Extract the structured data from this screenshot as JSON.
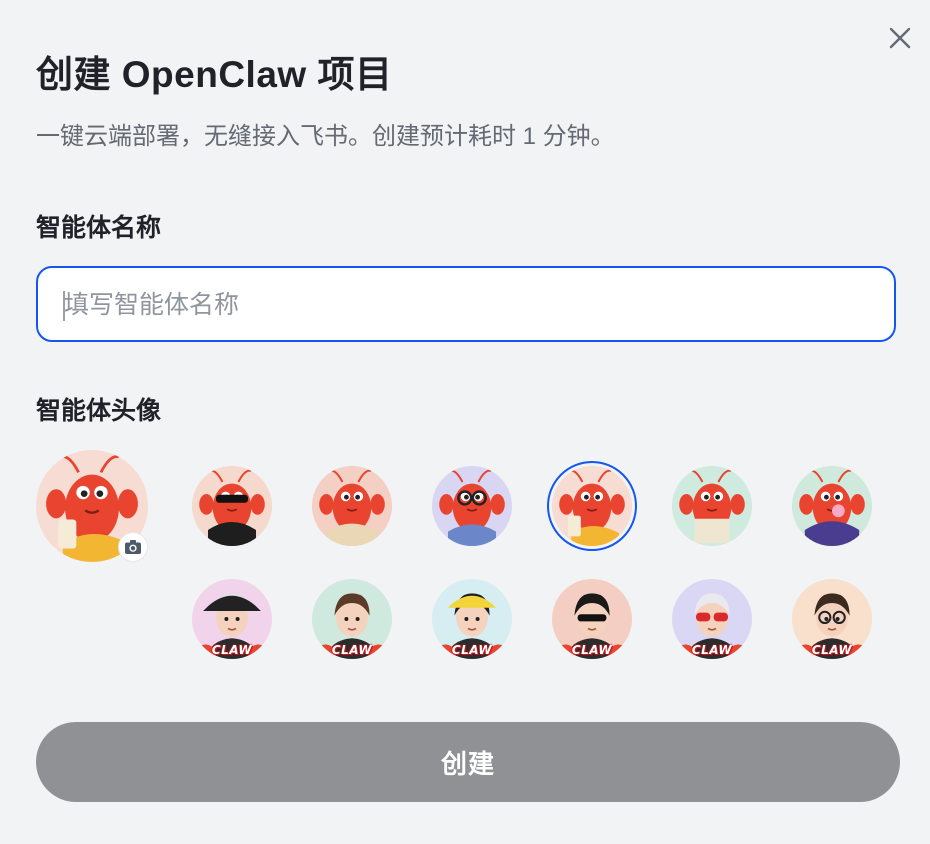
{
  "dialog": {
    "title": "创建 OpenClaw 项目",
    "subtitle": "一键云端部署，无缝接入飞书。创建预计耗时 1 分钟。",
    "close_icon": "close-icon"
  },
  "name_field": {
    "label": "智能体名称",
    "placeholder": "填写智能体名称",
    "value": ""
  },
  "avatar_field": {
    "label": "智能体头像",
    "current": {
      "name": "lobster-milk-tea",
      "bg": "#f6dcd2",
      "upload_icon": "camera-icon"
    },
    "selected_index": 3,
    "options": [
      {
        "name": "lobster-sunglasses",
        "bg": "#f5d9cc",
        "tag": ""
      },
      {
        "name": "lobster-sweater",
        "bg": "#f3cfc4",
        "tag": ""
      },
      {
        "name": "lobster-glasses-laptop",
        "bg": "#d9d6f3",
        "tag": ""
      },
      {
        "name": "lobster-milk-tea",
        "bg": "#f6dcd2",
        "tag": ""
      },
      {
        "name": "lobster-newspaper",
        "bg": "#cfeadf",
        "tag": ""
      },
      {
        "name": "lobster-hoodie-bubblegum",
        "bg": "#cfe9dc",
        "tag": ""
      },
      {
        "name": "girl-bucket-hat",
        "bg": "#f1d3ec",
        "tag": "CLAW"
      },
      {
        "name": "boy-brown-hair",
        "bg": "#cfe9de",
        "tag": "CLAW"
      },
      {
        "name": "girl-yellow-hat",
        "bg": "#d6eef2",
        "tag": "CLAW"
      },
      {
        "name": "boy-sunglasses",
        "bg": "#f4cdc3",
        "tag": "CLAW"
      },
      {
        "name": "girl-red-glasses",
        "bg": "#dad7f4",
        "tag": "CLAW"
      },
      {
        "name": "boy-round-glasses",
        "bg": "#f8e0cc",
        "tag": "CLAW"
      }
    ]
  },
  "actions": {
    "create_label": "创建",
    "create_disabled": true
  },
  "colors": {
    "accent": "#1456f0",
    "button_disabled": "#8f9195",
    "background": "#f2f3f5",
    "lobster": "#e8442f"
  }
}
